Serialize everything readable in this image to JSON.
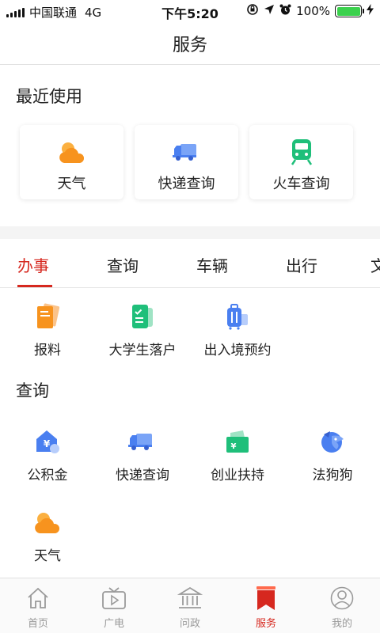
{
  "status_bar": {
    "carrier": "中国联通",
    "network": "4G",
    "time": "下午5:20",
    "battery_percent": "100%",
    "battery_level": 1.0
  },
  "nav": {
    "title": "服务"
  },
  "recent": {
    "title": "最近使用",
    "items": [
      {
        "label": "天气",
        "icon": "weather-icon"
      },
      {
        "label": "快递查询",
        "icon": "delivery-truck-icon"
      },
      {
        "label": "火车查询",
        "icon": "train-icon"
      }
    ]
  },
  "tabs": {
    "items": [
      {
        "label": "办事",
        "active": true
      },
      {
        "label": "查询",
        "active": false
      },
      {
        "label": "车辆",
        "active": false
      },
      {
        "label": "出行",
        "active": false
      },
      {
        "label": "文",
        "active": false
      }
    ],
    "active_color": "#d6281f"
  },
  "banshi": {
    "items": [
      {
        "label": "报料",
        "icon": "report-document-icon"
      },
      {
        "label": "大学生落户",
        "icon": "checklist-icon"
      },
      {
        "label": "出入境预约",
        "icon": "luggage-icon"
      }
    ]
  },
  "chaxun": {
    "title": "查询",
    "items": [
      {
        "label": "公积金",
        "icon": "housing-fund-icon"
      },
      {
        "label": "快递查询",
        "icon": "delivery-truck-icon"
      },
      {
        "label": "创业扶持",
        "icon": "money-wallet-icon"
      },
      {
        "label": "法狗狗",
        "icon": "dog-logo-icon"
      },
      {
        "label": "天气",
        "icon": "weather-icon"
      }
    ]
  },
  "tabbar": {
    "items": [
      {
        "label": "首页",
        "icon": "home-icon",
        "active": false
      },
      {
        "label": "广电",
        "icon": "tv-icon",
        "active": false
      },
      {
        "label": "问政",
        "icon": "government-building-icon",
        "active": false
      },
      {
        "label": "服务",
        "icon": "bookmark-service-icon",
        "active": true
      },
      {
        "label": "我的",
        "icon": "profile-icon",
        "active": false
      }
    ]
  },
  "colors": {
    "accent": "#d6281f",
    "weather_orange": "#f7931e",
    "blue": "#4a7ff0",
    "green": "#1fbf7a"
  }
}
